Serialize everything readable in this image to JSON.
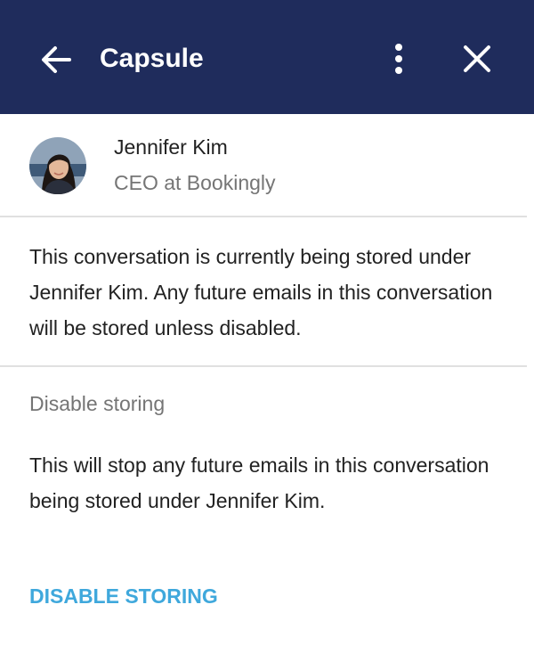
{
  "header": {
    "title": "Capsule",
    "back_icon": "arrow-left-icon",
    "more_icon": "more-vertical-icon",
    "close_icon": "close-icon",
    "background_color": "#1f2c5c"
  },
  "contact": {
    "name": "Jennifer Kim",
    "role": "CEO at Bookingly",
    "avatar_icon": "avatar"
  },
  "info": {
    "text": "This conversation is currently being stored under Jennifer Kim. Any future emails in this conversation will be stored unless disabled."
  },
  "disable_section": {
    "title": "Disable storing",
    "description": "This will stop any future emails in this conversation being stored under Jennifer Kim.",
    "action_label": "DISABLE STORING",
    "action_color": "#3fa8dc"
  }
}
